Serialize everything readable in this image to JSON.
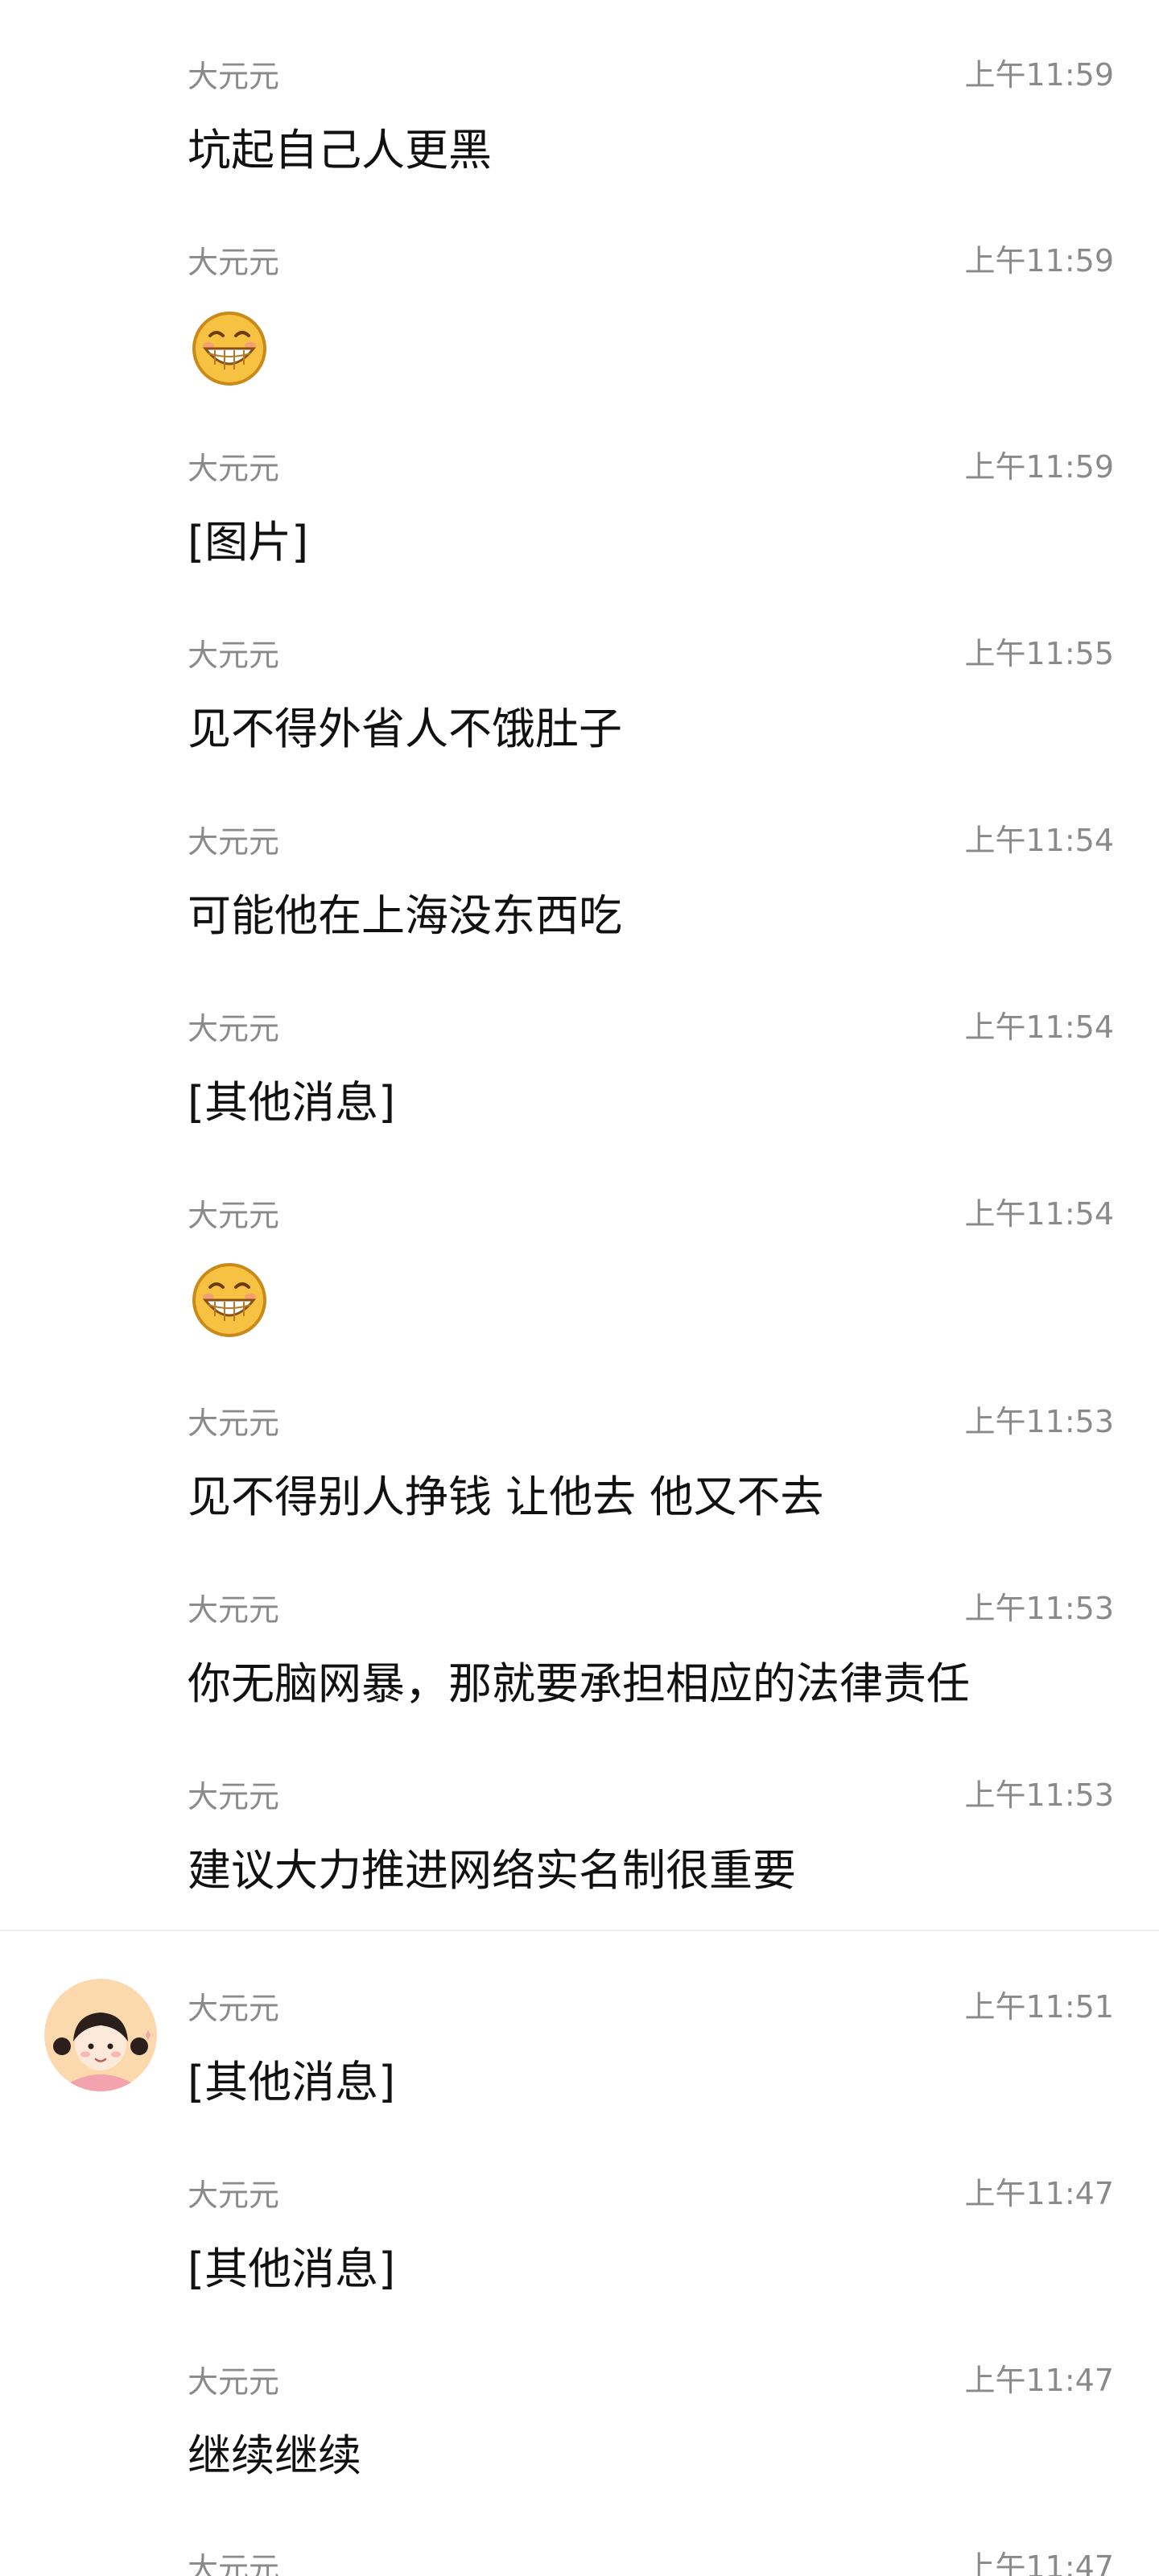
{
  "messages": [
    {
      "sender": "大元元",
      "time": "上午11:59",
      "content": "坑起自己人更黑"
    },
    {
      "sender": "大元元",
      "time": "上午11:59",
      "content": "",
      "emoji": "grinning-face-icon"
    },
    {
      "sender": "大元元",
      "time": "上午11:59",
      "content": "[图片]"
    },
    {
      "sender": "大元元",
      "time": "上午11:55",
      "content": "见不得外省人不饿肚子"
    },
    {
      "sender": "大元元",
      "time": "上午11:54",
      "content": "可能他在上海没东西吃"
    },
    {
      "sender": "大元元",
      "time": "上午11:54",
      "content": "[其他消息]"
    },
    {
      "sender": "大元元",
      "time": "上午11:54",
      "content": "",
      "emoji": "grinning-face-icon"
    },
    {
      "sender": "大元元",
      "time": "上午11:53",
      "content": "见不得别人挣钱 让他去 他又不去"
    },
    {
      "sender": "大元元",
      "time": "上午11:53",
      "content": "你无脑网暴，那就要承担相应的法律责任"
    },
    {
      "sender": "大元元",
      "time": "上午11:53",
      "content": "建议大力推进网络实名制很重要"
    },
    {
      "sender": "大元元",
      "time": "上午11:51",
      "content": "[其他消息]",
      "avatar": "girl-avatar"
    },
    {
      "sender": "大元元",
      "time": "上午11:47",
      "content": "[其他消息]"
    },
    {
      "sender": "大元元",
      "time": "上午11:47",
      "content": "继续继续"
    },
    {
      "sender": "大元元",
      "time": "上午11:47",
      "content": ""
    }
  ],
  "colors": {
    "meta_text": "#8a8a8a",
    "message_text": "#111111",
    "divider": "#eeeeee",
    "avatar_bg": "#fbd9ad"
  }
}
